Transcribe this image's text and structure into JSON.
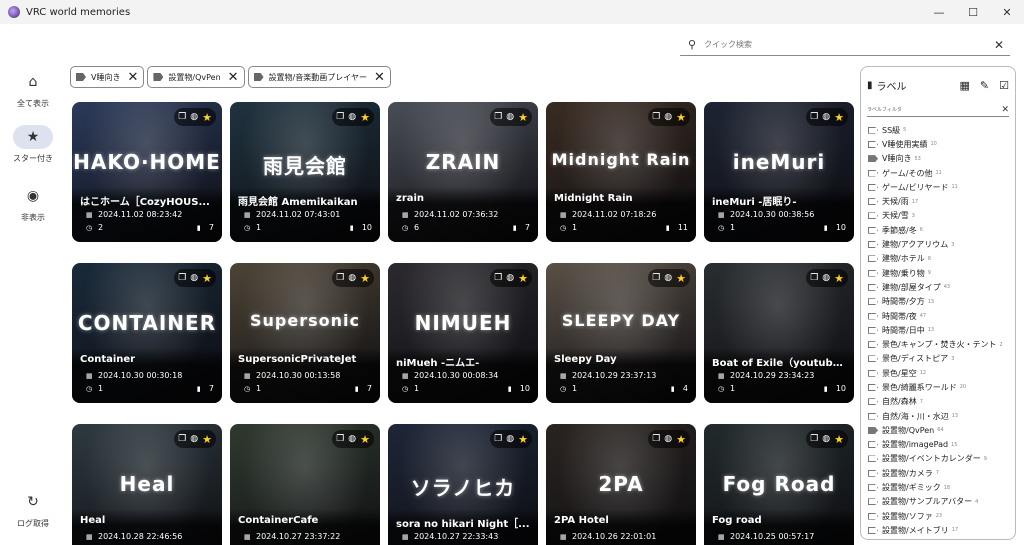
{
  "window": {
    "title": "VRC world memories",
    "minimize": "—",
    "maximize": "☐",
    "close": "✕"
  },
  "search": {
    "placeholder": "クイック検索",
    "value": ""
  },
  "nav": [
    {
      "label": "全て表示",
      "icon": "home-icon"
    },
    {
      "label": "スター付き",
      "icon": "star-icon",
      "active": true
    },
    {
      "label": "非表示",
      "icon": "hidden-eye-icon"
    },
    {
      "label": "ログ取得",
      "icon": "refresh-icon"
    }
  ],
  "filters": [
    "V睡向き",
    "設置物/QvPen",
    "設置物/音楽動画プレイヤー"
  ],
  "cards": [
    {
      "name": "はこホーム［CozyHOUS...",
      "date": "2024.11.02 08:23:42",
      "visits": "2",
      "pics": "7",
      "logo": "HAKO·HOME",
      "bg": "#2b3a5a"
    },
    {
      "name": "雨見会館 Amemikaikan",
      "date": "2024.11.02 07:43:01",
      "visits": "1",
      "pics": "10",
      "logo": "雨見会館",
      "bg": "#1f3340"
    },
    {
      "name": "zrain",
      "date": "2024.11.02 07:36:32",
      "visits": "6",
      "pics": "7",
      "logo": "ZRAIN",
      "bg": "#4a4e57"
    },
    {
      "name": "Midnight Rain",
      "date": "2024.11.02 07:18:26",
      "visits": "1",
      "pics": "11",
      "logo": "Midnight Rain",
      "bg": "#3a2c22"
    },
    {
      "name": "ineMuri -居眠り-",
      "date": "2024.10.30 00:38:56",
      "visits": "1",
      "pics": "10",
      "logo": "ineMuri",
      "bg": "#1e2433"
    },
    {
      "name": "Container",
      "date": "2024.10.30 00:30:18",
      "visits": "1",
      "pics": "7",
      "logo": "CONTAINER",
      "bg": "#1a2a3a"
    },
    {
      "name": "SupersonicPrivateJet",
      "date": "2024.10.30 00:13:58",
      "visits": "1",
      "pics": "7",
      "logo": "Supersonic",
      "bg": "#4d4436"
    },
    {
      "name": "niMueh -ニムエ-",
      "date": "2024.10.30 00:08:34",
      "visits": "1",
      "pics": "10",
      "logo": "NIMUEH",
      "bg": "#2c2a2e"
    },
    {
      "name": "Sleepy Day",
      "date": "2024.10.29 23:37:13",
      "visits": "1",
      "pics": "4",
      "logo": "SLEEPY DAY",
      "bg": "#5a5046"
    },
    {
      "name": "Boat of Exile（youtube...",
      "date": "2024.10.29 23:34:23",
      "visits": "1",
      "pics": "10",
      "logo": "",
      "bg": "#2a2e30"
    },
    {
      "name": "Heal",
      "date": "2024.10.28 22:46:56",
      "visits": "",
      "pics": "",
      "logo": "Heal",
      "bg": "#2e3a40"
    },
    {
      "name": "ContainerCafe",
      "date": "2024.10.27 23:37:22",
      "visits": "",
      "pics": "",
      "logo": "",
      "bg": "#303a30"
    },
    {
      "name": "sora no hikari Night［...",
      "date": "2024.10.27 22:33:43",
      "visits": "",
      "pics": "",
      "logo": "ソラノヒカ",
      "bg": "#1e2638"
    },
    {
      "name": "2PA Hotel",
      "date": "2024.10.26 22:01:01",
      "visits": "",
      "pics": "",
      "logo": "2PA",
      "bg": "#2a2420"
    },
    {
      "name": "Fog road",
      "date": "2024.10.25 00:57:17",
      "visits": "",
      "pics": "",
      "logo": "Fog Road",
      "bg": "#222a2c"
    }
  ],
  "panel": {
    "title": "ラベル",
    "filter_placeholder": "ラベルフィルタ",
    "labels": [
      {
        "name": "SS級",
        "count": "5"
      },
      {
        "name": "V睡使用実績",
        "count": "10"
      },
      {
        "name": "V睡向き",
        "count": "53",
        "on": true
      },
      {
        "name": "ゲーム/その他",
        "count": "11"
      },
      {
        "name": "ゲーム/ビリヤード",
        "count": "11"
      },
      {
        "name": "天候/雨",
        "count": "17"
      },
      {
        "name": "天候/雪",
        "count": "3"
      },
      {
        "name": "季節感/冬",
        "count": "6"
      },
      {
        "name": "建物/アクアリウム",
        "count": "3"
      },
      {
        "name": "建物/ホテル",
        "count": "8"
      },
      {
        "name": "建物/乗り物",
        "count": "9"
      },
      {
        "name": "建物/部屋タイプ",
        "count": "43"
      },
      {
        "name": "時間帯/夕方",
        "count": "13"
      },
      {
        "name": "時間帯/夜",
        "count": "47"
      },
      {
        "name": "時間帯/日中",
        "count": "13"
      },
      {
        "name": "景色/キャンプ・焚き火・テント",
        "count": "2"
      },
      {
        "name": "景色/ディストピア",
        "count": "3"
      },
      {
        "name": "景色/星空",
        "count": "12"
      },
      {
        "name": "景色/綺麗系ワールド",
        "count": "20"
      },
      {
        "name": "自然/森林",
        "count": "7"
      },
      {
        "name": "自然/海・川・水辺",
        "count": "13"
      },
      {
        "name": "設置物/QvPen",
        "count": "64",
        "on": true
      },
      {
        "name": "設置物/imagePad",
        "count": "15"
      },
      {
        "name": "設置物/イベントカレンダー",
        "count": "9"
      },
      {
        "name": "設置物/カメラ",
        "count": "7"
      },
      {
        "name": "設置物/ギミック",
        "count": "18"
      },
      {
        "name": "設置物/サンプルアバター",
        "count": "4"
      },
      {
        "name": "設置物/ソファ",
        "count": "23"
      },
      {
        "name": "設置物/メイトブリ",
        "count": "17"
      }
    ]
  }
}
